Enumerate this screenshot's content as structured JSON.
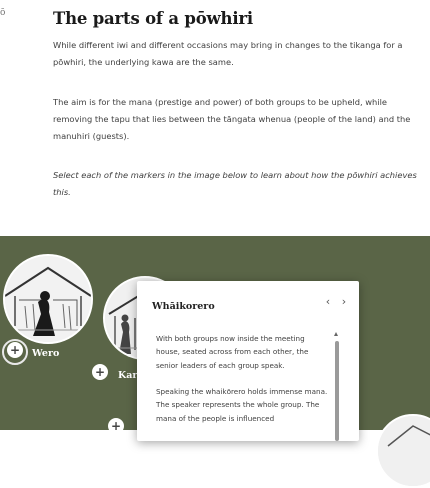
{
  "header": {
    "stray_glyph": "ō",
    "title": "The parts of a pōwhiri"
  },
  "intro": {
    "paragraph1": "While different iwi and different occasions may bring in changes to the tikanga for a pōwhiri, the underlying kawa are the same.",
    "paragraph2": "The aim is for the mana (prestige and power) of both groups to be upheld, while removing the tapu that lies between the tāngata whenua (people of the land) and the manuhiri (guests).",
    "instruction": "Select each of the markers in the image below to learn about how the pōwhiri achieves this."
  },
  "hotspots": [
    {
      "label": "Wero",
      "icon": "plus-icon",
      "glyph": "+"
    },
    {
      "label": "Kar",
      "icon": "plus-icon",
      "glyph": "+"
    },
    {
      "label": "",
      "icon": "plus-icon",
      "glyph": "+"
    }
  ],
  "panel": {
    "title": "Whāikorero",
    "prev_glyph": "‹",
    "next_glyph": "›",
    "body": [
      "With both groups now inside the meeting house, seated across from each other, the senior leaders of each group speak.",
      "Speaking the whaikōrero holds immense mana. The speaker represents the whole group. The mana of the people is influenced"
    ]
  },
  "colors": {
    "band_background": "#5a6547",
    "title_text": "#1a1a1a",
    "body_text": "#3f3f3f",
    "marker_fill": "#ffffff"
  }
}
